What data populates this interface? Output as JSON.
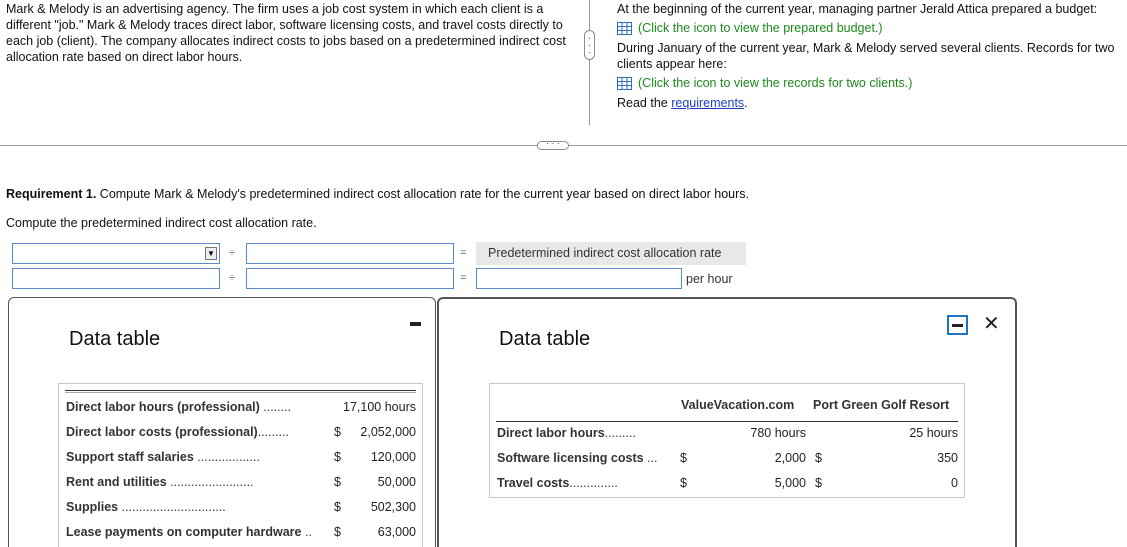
{
  "intro_left": "Mark & Melody is an advertising agency. The firm uses a job cost system in which each client is a different \"job.\" Mark & Melody traces direct labor, software licensing costs, and travel costs directly to each job (client). The company allocates indirect costs to jobs based on a predetermined indirect cost allocation rate based on direct labor hours.",
  "intro_right": {
    "line1": "At the beginning of the current year, managing partner Jerald Attica prepared a budget:",
    "budget_link": "(Click the icon to view the prepared budget.)",
    "line2": "During January of the current year, Mark & Melody served several clients. Records for two clients appear here:",
    "records_link": "(Click the icon to view the records for two clients.)",
    "read_prefix": "Read the ",
    "requirements_link": "requirements",
    "read_suffix": "."
  },
  "requirement": {
    "label": "Requirement 1.",
    "text": " Compute Mark & Melody's predetermined indirect cost allocation rate for the current year based on direct labor hours."
  },
  "compute_text": "Compute the predetermined indirect cost allocation rate.",
  "formula": {
    "op_divide": "÷",
    "op_equals": "=",
    "result_label": "Predetermined indirect cost allocation rate",
    "per_hour": "per hour"
  },
  "data_table_left": {
    "title": "Data table",
    "rows": [
      {
        "label": "Direct labor hours (professional)",
        "dots": " ........",
        "dollar": "",
        "value": "17,100 hours"
      },
      {
        "label": "Direct labor costs (professional)",
        "dots": ".........",
        "dollar": "$",
        "value": "2,052,000"
      },
      {
        "label": "Support staff salaries",
        "dots": " ..................",
        "dollar": "$",
        "value": "120,000"
      },
      {
        "label": "Rent and utilities",
        "dots": " ........................",
        "dollar": "$",
        "value": "50,000"
      },
      {
        "label": "Supplies",
        "dots": " ..............................",
        "dollar": "$",
        "value": "502,300"
      },
      {
        "label": "Lease payments on computer hardware",
        "dots": " ..",
        "dollar": "$",
        "value": "63,000"
      }
    ]
  },
  "data_table_right": {
    "title": "Data table",
    "headers": [
      "ValueVacation.com",
      "Port Green Golf Resort"
    ],
    "rows": [
      {
        "label": "Direct labor hours",
        "dots": ".........",
        "d1": "",
        "c1": "780 hours",
        "d2": "",
        "c2": "25 hours"
      },
      {
        "label": "Software licensing costs",
        "dots": " ...",
        "d1": "$",
        "c1": "2,000",
        "d2": "$",
        "c2": "350"
      },
      {
        "label": "Travel costs",
        "dots": "..............",
        "d1": "$",
        "c1": "5,000",
        "d2": "$",
        "c2": "0"
      }
    ]
  },
  "window_controls": {
    "close": "✕"
  },
  "colors": {
    "link_green": "#1a8a1a",
    "link_blue": "#1f3fbf",
    "input_border": "#5b8ac9",
    "window_button": "#1f73c6"
  }
}
